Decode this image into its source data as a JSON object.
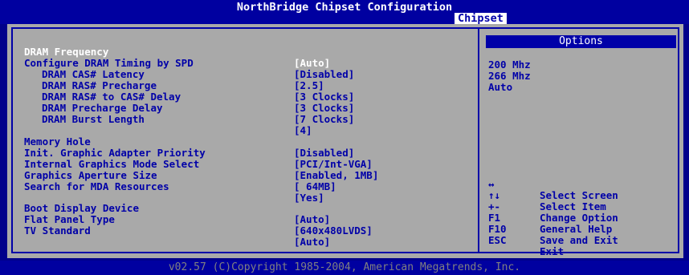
{
  "header": {
    "title": "NorthBridge Chipset Configuration",
    "tab": "Chipset"
  },
  "settings": [
    {
      "label": "DRAM Frequency",
      "value": "[Auto]"
    },
    {
      "label": "Configure DRAM Timing by SPD",
      "value": "[Disabled]"
    },
    {
      "label": "DRAM CAS# Latency",
      "value": "[2.5]"
    },
    {
      "label": "DRAM RAS# Precharge",
      "value": "[3 Clocks]"
    },
    {
      "label": "DRAM RAS# to CAS# Delay",
      "value": "[3 Clocks]"
    },
    {
      "label": "DRAM Precharge Delay",
      "value": "[7 Clocks]"
    },
    {
      "label": "DRAM Burst Length",
      "value": "[4]"
    },
    {
      "label": "Memory Hole",
      "value": "[Disabled]"
    },
    {
      "label": "Init. Graphic Adapter Priority",
      "value": "[PCI/Int-VGA]"
    },
    {
      "label": "Internal Graphics Mode Select",
      "value": "[Enabled, 1MB]"
    },
    {
      "label": "Graphics Aperture Size",
      "value": "[ 64MB]"
    },
    {
      "label": "Search for MDA Resources",
      "value": "[Yes]"
    },
    {
      "label": "Boot Display Device",
      "value": "[Auto]"
    },
    {
      "label": "Flat Panel Type",
      "value": "[640x480LVDS]"
    },
    {
      "label": "TV Standard",
      "value": "[Auto]"
    }
  ],
  "options": {
    "title": "Options",
    "items": [
      "200 Mhz",
      "266 Mhz",
      "Auto"
    ]
  },
  "help": [
    {
      "key": "↔",
      "desc": "Select Screen"
    },
    {
      "key": "↑↓",
      "desc": "Select Item"
    },
    {
      "key": "+-",
      "desc": "Change Option"
    },
    {
      "key": "F1",
      "desc": "General Help"
    },
    {
      "key": "F10",
      "desc": "Save and Exit"
    },
    {
      "key": "ESC",
      "desc": "Exit"
    }
  ],
  "footer": "v02.57 (C)Copyright 1985-2004, American Megatrends, Inc."
}
